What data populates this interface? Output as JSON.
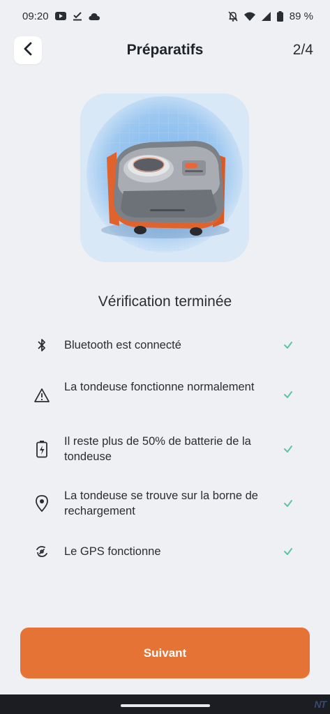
{
  "status_bar": {
    "time": "09:20",
    "battery": "89 %",
    "left_icons": [
      "youtube-icon",
      "download-done-icon",
      "cloud-icon"
    ],
    "right_icons": [
      "bell-off-icon",
      "wifi-icon",
      "signal-icon",
      "battery-icon"
    ]
  },
  "header": {
    "title": "Préparatifs",
    "step": "2/4",
    "back_icon": "chevron-left-icon"
  },
  "hero": {
    "image": "robot-lawn-mower",
    "background": "#cfe3f6"
  },
  "check_title": "Vérification terminée",
  "checks": [
    {
      "icon": "bluetooth-icon",
      "label": "Bluetooth est connecté",
      "status": "ok"
    },
    {
      "icon": "warning-icon",
      "label": "La tondeuse fonctionne normalement",
      "status": "ok"
    },
    {
      "icon": "battery-charging-icon",
      "label": "Il reste plus de 50% de batterie de la tondeuse",
      "status": "ok"
    },
    {
      "icon": "location-pin-icon",
      "label": "La tondeuse se trouve sur la borne de rechargement",
      "status": "ok"
    },
    {
      "icon": "gps-signal-icon",
      "label": "Le GPS fonctionne",
      "status": "ok"
    }
  ],
  "next_button": {
    "label": "Suivant"
  },
  "watermark": "NT",
  "colors": {
    "accent": "#e57336",
    "check": "#5cc4a8",
    "background": "#eef0f3"
  }
}
